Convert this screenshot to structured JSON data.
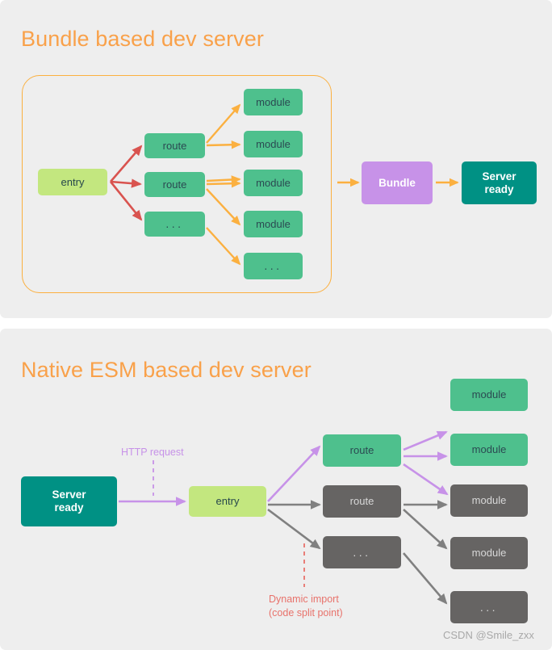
{
  "meta": {
    "watermark": "CSDN @Smile_zxx"
  },
  "colors": {
    "panel_bg": "#eeeeee",
    "title_orange": "#f9a14a",
    "edge_orange": "#fbb040",
    "edge_red": "#d9534f",
    "edge_purple": "#c792e8",
    "edge_gray": "#808080",
    "node_entry_green": "#c3e77f",
    "node_green": "#4ec08d",
    "node_gray": "#666463",
    "node_purple": "#c792e8",
    "node_teal": "#009184",
    "dynamic_red": "#e8726b"
  },
  "panel_bundle": {
    "title": "Bundle based dev server",
    "entry": {
      "label": "entry"
    },
    "routes": [
      {
        "label": "route"
      },
      {
        "label": "route"
      },
      {
        "label": "..."
      }
    ],
    "modules": [
      {
        "label": "module"
      },
      {
        "label": "module"
      },
      {
        "label": "module"
      },
      {
        "label": "module"
      },
      {
        "label": "..."
      }
    ],
    "bundle": {
      "label": "Bundle"
    },
    "server_ready": {
      "label": "Server\nready",
      "line1": "Server",
      "line2": "ready"
    }
  },
  "panel_esm": {
    "title": "Native ESM based dev server",
    "server_ready": {
      "line1": "Server",
      "line2": "ready"
    },
    "entry": {
      "label": "entry"
    },
    "http_request_label": "HTTP request",
    "dynamic_import_label": {
      "line1": "Dynamic import",
      "line2": "(code split point)"
    },
    "routes": [
      {
        "label": "route",
        "style": "green"
      },
      {
        "label": "route",
        "style": "gray"
      },
      {
        "label": "...",
        "style": "gray"
      }
    ],
    "modules": [
      {
        "label": "module",
        "style": "green"
      },
      {
        "label": "module",
        "style": "green"
      },
      {
        "label": "module",
        "style": "gray"
      },
      {
        "label": "module",
        "style": "gray"
      },
      {
        "label": "...",
        "style": "gray"
      }
    ]
  }
}
